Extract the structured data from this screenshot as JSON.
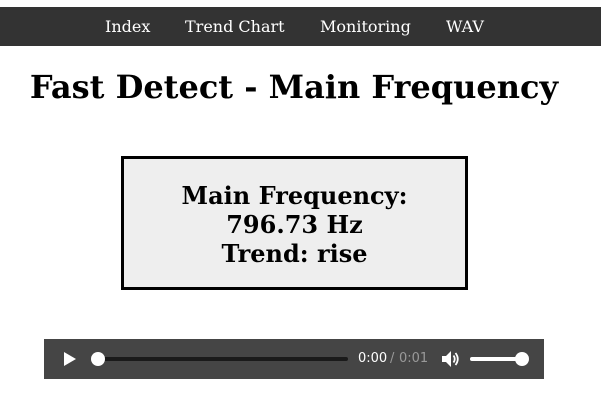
{
  "nav": {
    "items": [
      {
        "label": "Index"
      },
      {
        "label": "Trend Chart"
      },
      {
        "label": "Monitoring"
      },
      {
        "label": "WAV"
      }
    ]
  },
  "page": {
    "title": "Fast Detect - Main Frequency"
  },
  "frequency_panel": {
    "label": "Main Frequency:",
    "value": "796.73 Hz",
    "trend": "Trend: rise"
  },
  "audio_player": {
    "current_time": "0:00",
    "separator": "/",
    "duration": "0:01",
    "progress_fraction": 0.0,
    "volume_fraction": 1.0,
    "icons": {
      "play": "play-icon",
      "volume": "volume-icon"
    }
  },
  "colors": {
    "navbar_bg": "#333333",
    "panel_bg": "#eeeeee",
    "player_bg": "#454545"
  }
}
